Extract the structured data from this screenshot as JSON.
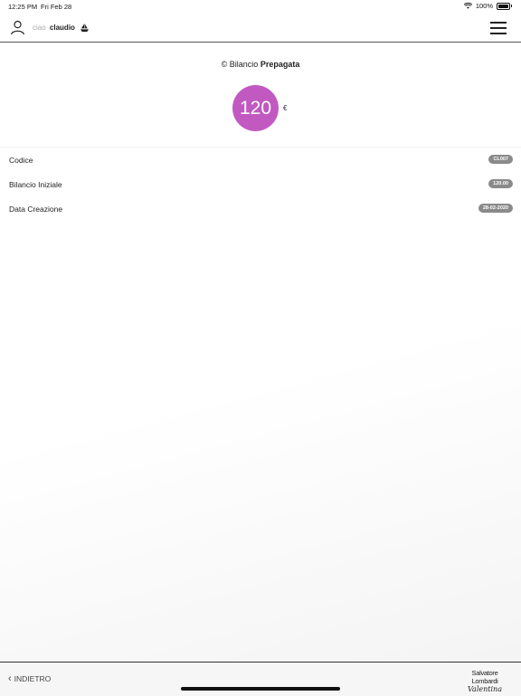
{
  "status_bar": {
    "time": "12:25 PM",
    "date": "Fri Feb 28",
    "battery": "100%",
    "icons": [
      "wifi-icon",
      "battery-icon"
    ]
  },
  "header": {
    "greeting_prefix": "ciao",
    "user_name": "claudio",
    "icons": [
      "user-icon",
      "boat-icon",
      "menu-icon"
    ]
  },
  "balance": {
    "title_prefix": "Bilancio",
    "title_bold": "Prepagata",
    "copyright_symbol": "©",
    "amount": "120",
    "currency": "€",
    "circle_color": "#c159c1"
  },
  "details": [
    {
      "label": "Codice",
      "value": "CL007"
    },
    {
      "label": "Bilancio Iniziale",
      "value": "120.00"
    },
    {
      "label": "Data Creazione",
      "value": "28-02-2020"
    }
  ],
  "footer": {
    "back_label": "INDIETRO",
    "brand_line1": "Salvatore Lombardi",
    "brand_line2": "Valentina"
  }
}
